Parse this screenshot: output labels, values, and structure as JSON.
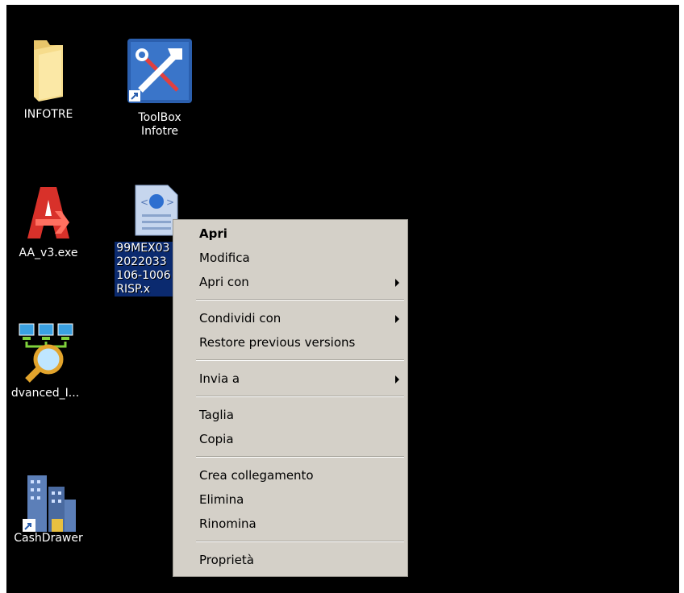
{
  "desktop": {
    "icons": [
      {
        "label": "INFOTRE",
        "icon": "folder-icon"
      },
      {
        "label": "ToolBox\nInfotre",
        "icon": "toolbox-icon"
      },
      {
        "label": "AA_v3.exe",
        "icon": "ammyy-admin-icon"
      },
      {
        "label": "99MEX03\n2022033\n106-1006\nRISP.x",
        "icon": "xml-file-icon"
      },
      {
        "label": "dvanced_I...",
        "icon": "network-scanner-icon"
      },
      {
        "label": "CashDrawer",
        "icon": "buildings-icon"
      }
    ]
  },
  "context_menu": {
    "items": [
      {
        "label": "Apri",
        "bold": true,
        "submenu": false
      },
      {
        "label": "Modifica",
        "submenu": false
      },
      {
        "label": "Apri con",
        "submenu": true
      },
      {
        "label": "Condividi con",
        "submenu": true
      },
      {
        "label": "Restore previous versions",
        "submenu": false
      },
      {
        "label": "Invia a",
        "submenu": true
      },
      {
        "label": "Taglia",
        "submenu": false
      },
      {
        "label": "Copia",
        "submenu": false
      },
      {
        "label": "Crea collegamento",
        "submenu": false
      },
      {
        "label": "Elimina",
        "submenu": false
      },
      {
        "label": "Rinomina",
        "submenu": false
      },
      {
        "label": "Proprietà",
        "submenu": false
      }
    ]
  },
  "colors": {
    "desktop_bg": "#000000",
    "menu_bg": "#d4d0c8",
    "selection": "#0b2a6f"
  }
}
